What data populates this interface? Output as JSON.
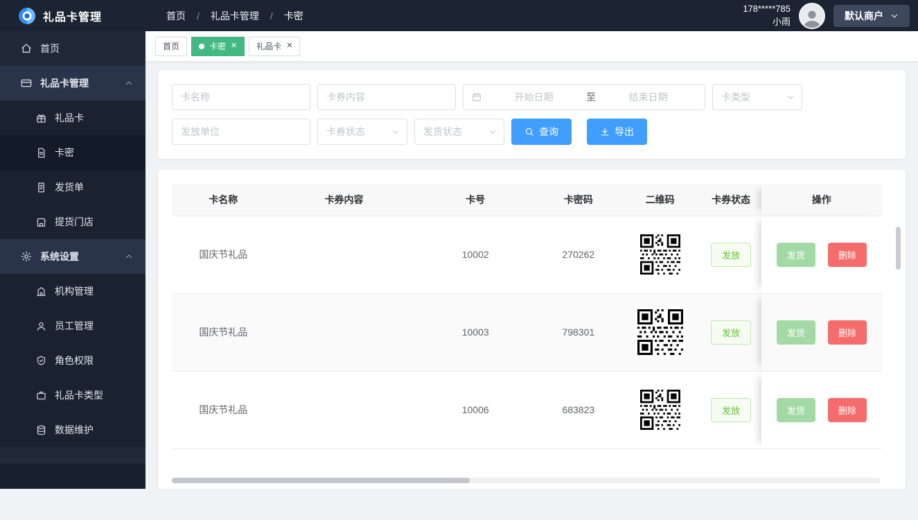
{
  "header": {
    "app_title": "礼品卡管理",
    "breadcrumb": [
      "首页",
      "礼品卡管理",
      "卡密"
    ],
    "breadcrumb_separator": "/",
    "user_phone": "178*****785",
    "user_name": "小雨",
    "merchant_label": "默认商户"
  },
  "sidebar": {
    "home": "首页",
    "gift_section": "礼品卡管理",
    "gift_children": [
      "礼品卡",
      "卡密",
      "发货单",
      "提货门店"
    ],
    "system_section": "系统设置",
    "system_children": [
      "机构管理",
      "员工管理",
      "角色权限",
      "礼品卡类型",
      "数据维护"
    ]
  },
  "tabs": [
    {
      "label": "首页",
      "closable": false,
      "active": false
    },
    {
      "label": "卡密",
      "closable": true,
      "active": true
    },
    {
      "label": "礼品卡",
      "closable": true,
      "active": false
    }
  ],
  "filters": {
    "card_name_placeholder": "卡名称",
    "card_content_placeholder": "卡券内容",
    "start_date_placeholder": "开始日期",
    "date_separator": "至",
    "end_date_placeholder": "结束日期",
    "card_type_placeholder": "卡类型",
    "issue_unit_placeholder": "发放单位",
    "card_status_placeholder": "卡券状态",
    "ship_status_placeholder": "发货状态",
    "search_button": "查询",
    "export_button": "导出"
  },
  "table": {
    "columns": [
      "卡名称",
      "卡券内容",
      "卡号",
      "卡密码",
      "二维码",
      "卡券状态",
      "操作"
    ],
    "rows": [
      {
        "card_name": "国庆节礼品",
        "card_content": "",
        "card_no": "10002",
        "card_password": "270262",
        "status": "发放"
      },
      {
        "card_name": "国庆节礼品",
        "card_content": "",
        "card_no": "10003",
        "card_password": "798301",
        "status": "发放"
      },
      {
        "card_name": "国庆节礼品",
        "card_content": "",
        "card_no": "10006",
        "card_password": "683823",
        "status": "发放"
      }
    ],
    "action_ship": "发货",
    "action_delete": "删除"
  },
  "icons": {
    "close": "✕"
  },
  "colors": {
    "primary": "#409eff",
    "tab_active_green": "#42b983",
    "status_green": "#67c23a",
    "ship_button_green": "#a3d9a5",
    "delete_red": "#f56c6c",
    "topbar_dark": "#1c2433",
    "sidebar_dark": "#202938"
  }
}
